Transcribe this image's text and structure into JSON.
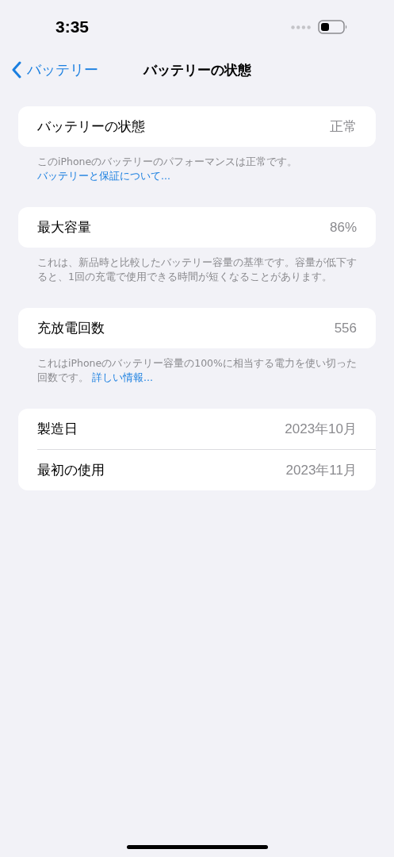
{
  "status_bar": {
    "time": "3:35"
  },
  "nav": {
    "back_label": "バッテリー",
    "title": "バッテリーの状態"
  },
  "sections": [
    {
      "rows": [
        {
          "label": "バッテリーの状態",
          "value": "正常"
        }
      ],
      "footer": {
        "text": "このiPhoneのバッテリーのパフォーマンスは正常です。",
        "link": "バッテリーと保証について..."
      }
    },
    {
      "rows": [
        {
          "label": "最大容量",
          "value": "86%"
        }
      ],
      "footer": {
        "text": "これは、新品時と比較したバッテリー容量の基準です。容量が低下すると、1回の充電で使用できる時間が短くなることがあります。"
      }
    },
    {
      "rows": [
        {
          "label": "充放電回数",
          "value": "556"
        }
      ],
      "footer": {
        "text": "これはiPhoneのバッテリー容量の100%に相当する電力を使い切った回数です。",
        "link": "詳しい情報..."
      }
    },
    {
      "rows": [
        {
          "label": "製造日",
          "value": "2023年10月"
        },
        {
          "label": "最初の使用",
          "value": "2023年11月"
        }
      ]
    }
  ]
}
